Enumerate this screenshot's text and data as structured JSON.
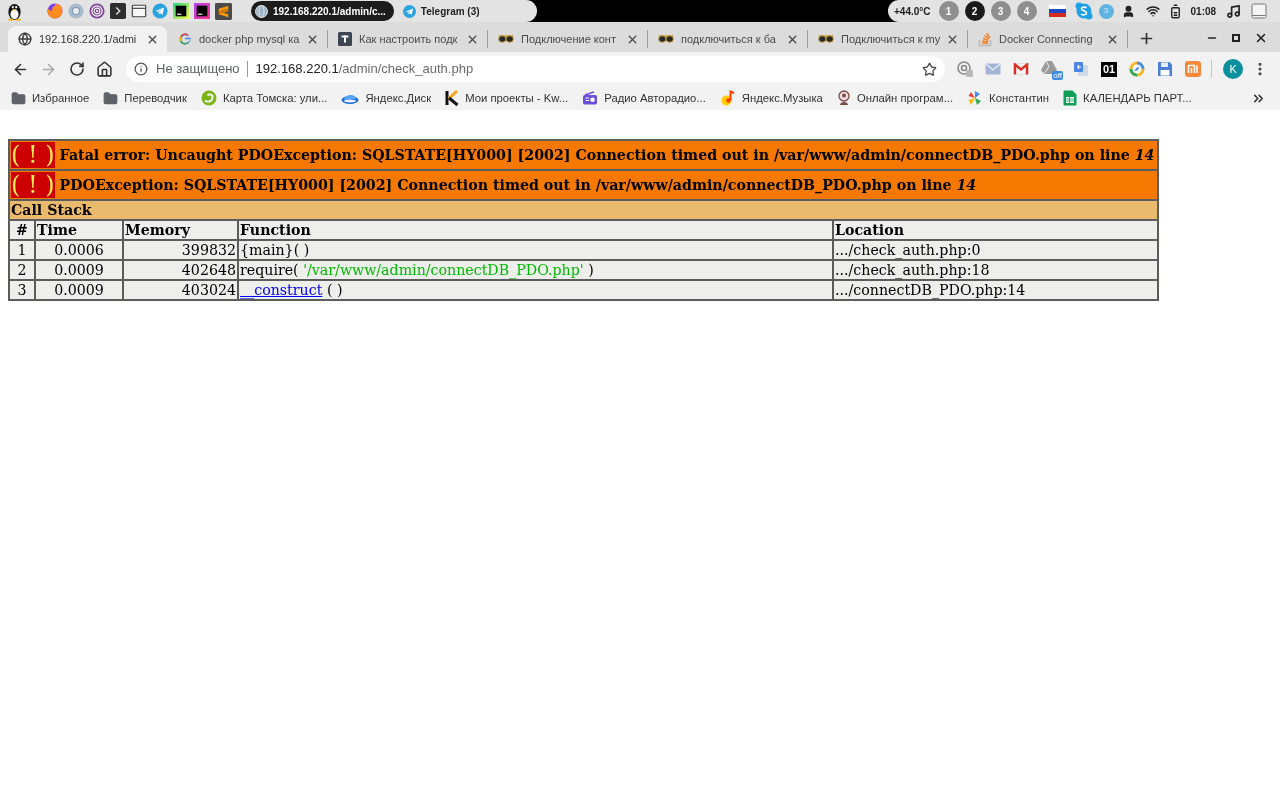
{
  "taskbar": {
    "tasks": [
      {
        "label": "192.168.220.1/admin/c...",
        "kind": "browser",
        "selected": true
      },
      {
        "label": "Telegram (3)",
        "kind": "telegram",
        "selected": false
      }
    ],
    "temperature": "+44.0°C",
    "workspaces": [
      {
        "label": "1",
        "selected": false
      },
      {
        "label": "2",
        "selected": true
      },
      {
        "label": "3",
        "selected": false
      },
      {
        "label": "4",
        "selected": false
      }
    ],
    "tray_count": "3",
    "clock": "01:08"
  },
  "tabs": [
    {
      "title": "192.168.220.1/admi",
      "kind": "globe",
      "selected": true
    },
    {
      "title": "docker php mysql ка",
      "kind": "google",
      "selected": false
    },
    {
      "title": "Как настроить подк",
      "kind": "tile",
      "selected": false
    },
    {
      "title": "Подключение конт",
      "kind": "sunglasses",
      "selected": false
    },
    {
      "title": "подключиться к ба",
      "kind": "sunglasses",
      "selected": false
    },
    {
      "title": "Подключиться к my",
      "kind": "sunglasses",
      "selected": false
    },
    {
      "title": "Docker Connecting",
      "kind": "stack",
      "selected": false
    }
  ],
  "toolbar": {
    "forward_disabled": true,
    "security": "Не защищено",
    "url_host": "192.168.220.1",
    "url_path": "/admin/check_auth.php",
    "extensions": [
      {
        "kind": "target"
      },
      {
        "kind": "mail"
      },
      {
        "kind": "gmail"
      },
      {
        "kind": "drive",
        "badge": "off"
      },
      {
        "kind": "translate"
      },
      {
        "kind": "label",
        "label": "01"
      },
      {
        "kind": "compass"
      },
      {
        "kind": "floppy"
      },
      {
        "kind": "mi"
      }
    ],
    "avatar": "K"
  },
  "bookmarks": [
    {
      "label": "Избранное",
      "kind": "folder"
    },
    {
      "label": "Переводчик",
      "kind": "folder"
    },
    {
      "label": "Карта Томска: ули...",
      "kind": "map"
    },
    {
      "label": "Яндекс.Диск",
      "kind": "disk"
    },
    {
      "label": "Мои проекты - Kw...",
      "kind": "bars"
    },
    {
      "label": "Радио Авторадио...",
      "kind": "radio"
    },
    {
      "label": "Яндекс.Музыка",
      "kind": "music"
    },
    {
      "label": "Онлайн програм...",
      "kind": "figure"
    },
    {
      "label": "Константин",
      "kind": "pinwheel"
    },
    {
      "label": "КАЛЕНДАРЬ ПАРТ...",
      "kind": "sheet"
    }
  ],
  "error_table": {
    "errors": [
      {
        "symbol": "( ! )",
        "message": "Fatal error: Uncaught PDOException: SQLSTATE[HY000] [2002] Connection timed out in /var/www/admin/connectDB_PDO.php on line *14*"
      },
      {
        "symbol": "( ! )",
        "message": "PDOException: SQLSTATE[HY000] [2002] Connection timed out in /var/www/admin/connectDB_PDO.php on line *14*"
      }
    ],
    "call_stack": {
      "title": "Call Stack",
      "columns": [
        "#",
        "Time",
        "Memory",
        "Function",
        "Location"
      ],
      "rows": [
        {
          "number": "1",
          "time": "0.0006",
          "memory": "399832",
          "function": [
            {
              "kind": "text",
              "text": "{main}( )"
            }
          ],
          "location": ".../check_auth.php:0"
        },
        {
          "number": "2",
          "time": "0.0009",
          "memory": "402648",
          "function": [
            {
              "kind": "text",
              "text": "require("
            },
            {
              "kind": "string",
              "text": "'/var/www/admin/connectDB_PDO.php'"
            },
            {
              "kind": "text",
              "text": ")"
            }
          ],
          "location": ".../check_auth.php:18"
        },
        {
          "number": "3",
          "time": "0.0009",
          "memory": "403024",
          "function": [
            {
              "kind": "link",
              "text": "__construct"
            },
            {
              "kind": "text",
              "text": "( )"
            }
          ],
          "location": ".../connectDB_PDO.php:14"
        }
      ]
    }
  }
}
